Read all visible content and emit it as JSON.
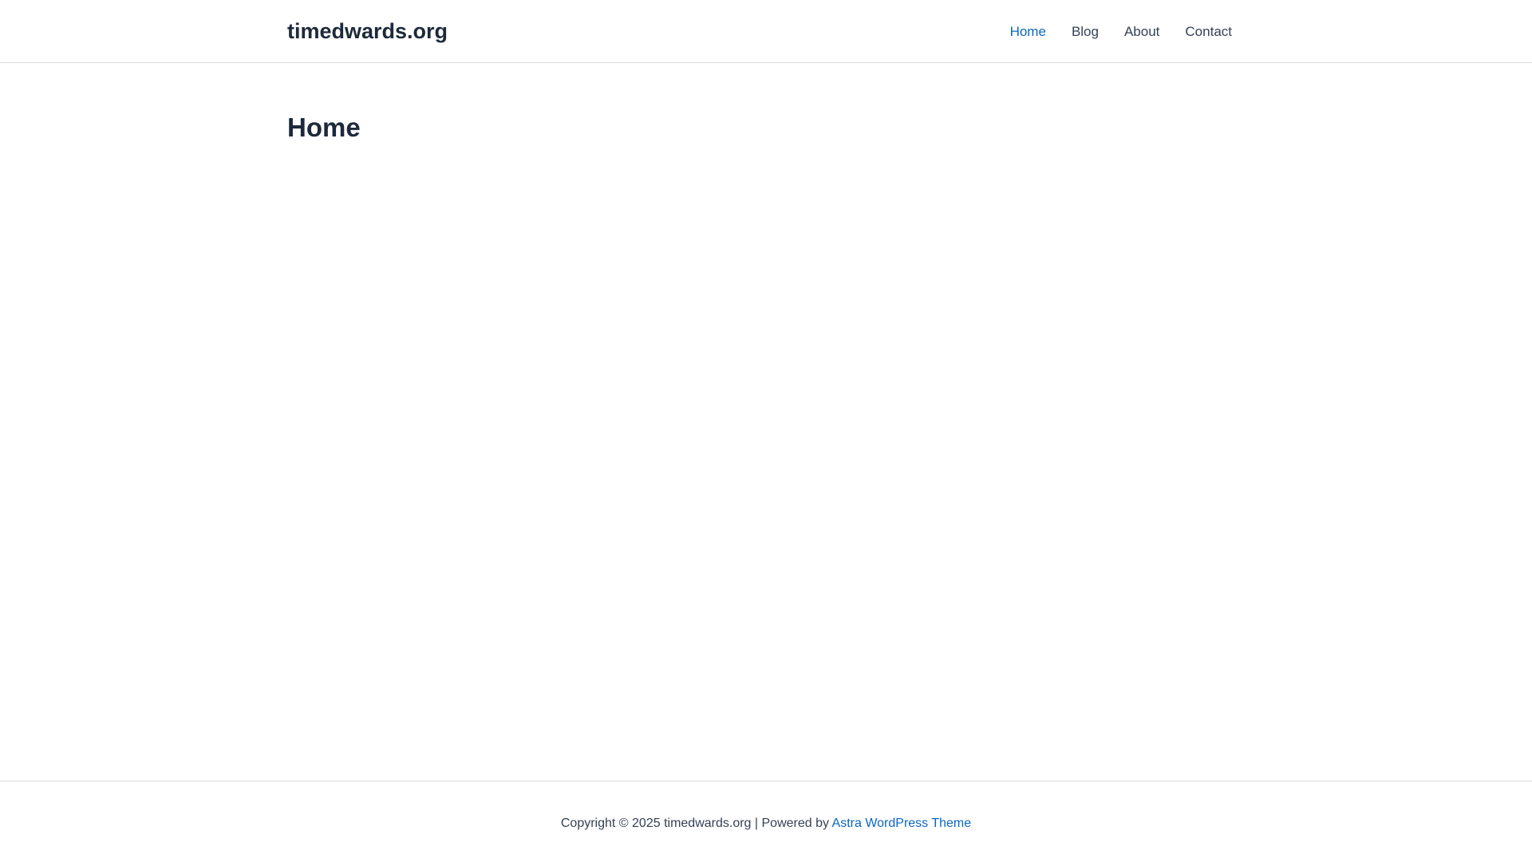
{
  "header": {
    "site_title": "timedwards.org",
    "nav": {
      "items": [
        {
          "label": "Home",
          "active": true
        },
        {
          "label": "Blog",
          "active": false
        },
        {
          "label": "About",
          "active": false
        },
        {
          "label": "Contact",
          "active": false
        }
      ]
    }
  },
  "main": {
    "page_title": "Home"
  },
  "footer": {
    "copyright_text": "Copyright © 2025 timedwards.org | Powered by ",
    "theme_link": "Astra WordPress Theme"
  },
  "colors": {
    "accent": "#0a67c2",
    "heading": "#1e293b",
    "text": "#334155",
    "border": "#dcdcdc"
  }
}
